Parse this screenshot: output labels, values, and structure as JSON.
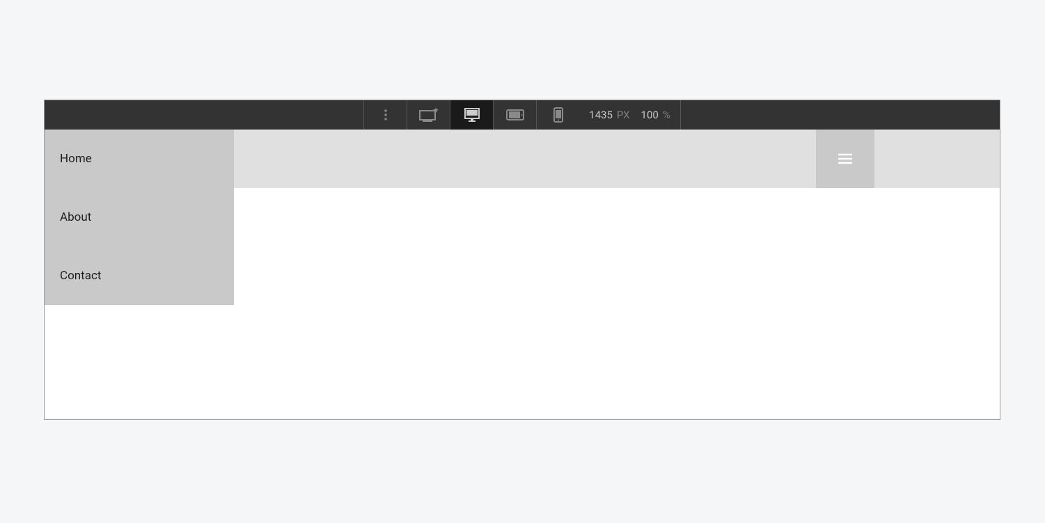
{
  "toolbar": {
    "viewport_width": "1435",
    "viewport_width_unit": "PX",
    "zoom": "100",
    "zoom_unit": "%"
  },
  "nav": {
    "items": [
      {
        "label": "Home"
      },
      {
        "label": "About"
      },
      {
        "label": "Contact"
      }
    ]
  }
}
